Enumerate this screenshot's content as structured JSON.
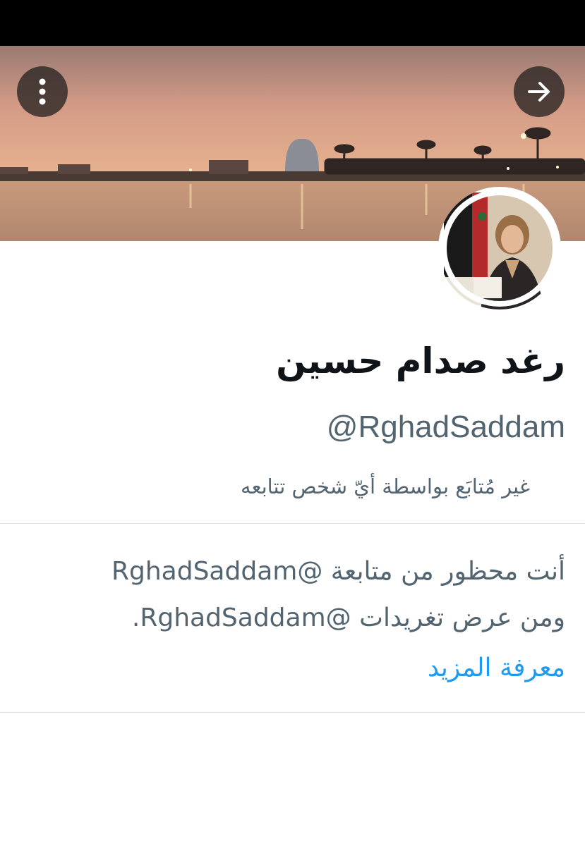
{
  "profile": {
    "display_name": "رغد صدام حسين",
    "handle": "@RghadSaddam",
    "follow_status": "غير مُتابَع بواسطة أيّ شخص تتابعه"
  },
  "header": {
    "menu_icon": "more-vertical-icon",
    "forward_icon": "arrow-right-icon"
  },
  "blocked": {
    "line1": "أنت محظور من متابعة @RghadSaddam",
    "line2": "ومن عرض تغريدات @RghadSaddam.",
    "learn_more": "معرفة المزيد"
  },
  "colors": {
    "primary_text": "#0f1419",
    "secondary_text": "#536471",
    "link": "#1d9bf0"
  }
}
